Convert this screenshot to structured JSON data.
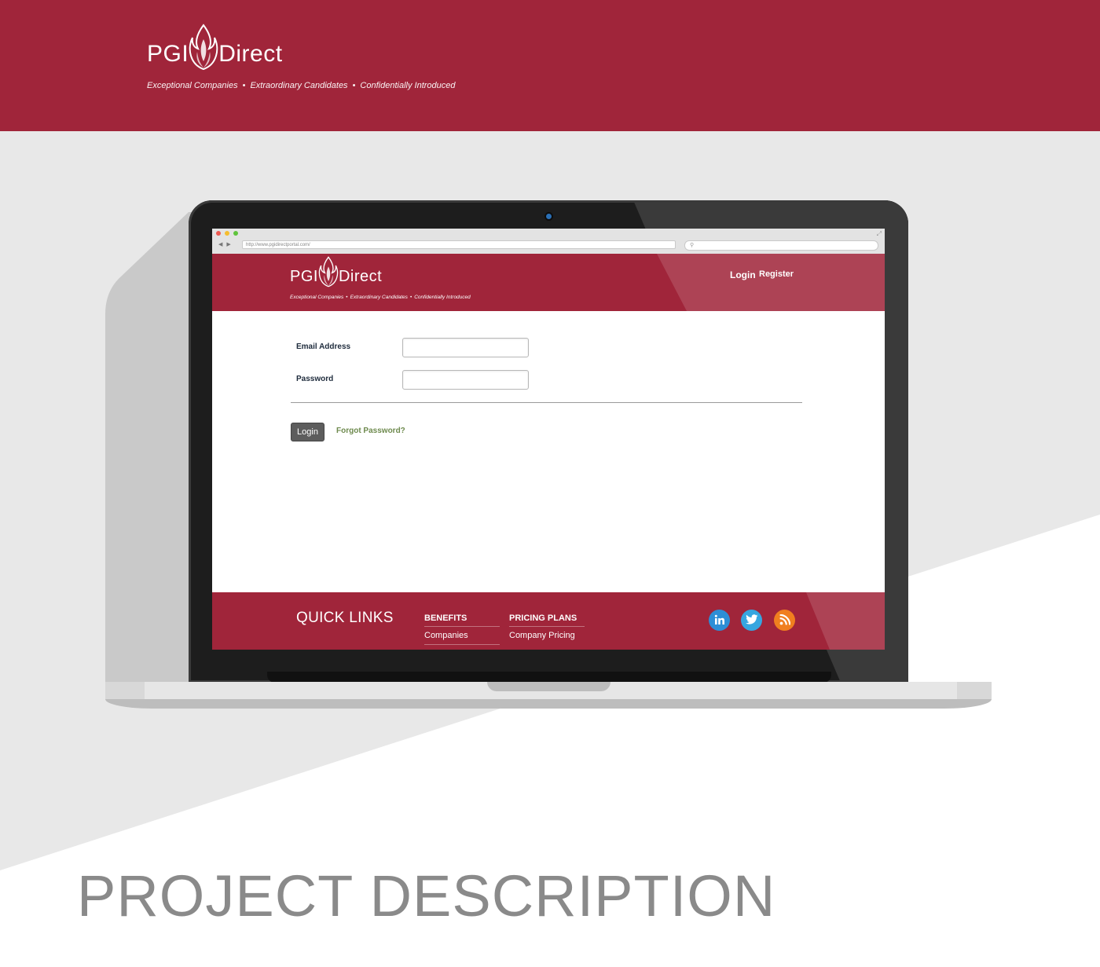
{
  "brand": {
    "name_left": "PGI",
    "name_right": "Direct",
    "tagline": [
      "Exceptional Companies",
      "Extraordinary Candidates",
      "Confidentially Introduced"
    ],
    "tagline_separator": "•",
    "color": "#a0253a"
  },
  "browser": {
    "url": "http://www.pgidirectportal.com/"
  },
  "site": {
    "nav": {
      "login": "Login",
      "register": "Register"
    },
    "form": {
      "email_label": "Email Address",
      "password_label": "Password",
      "login_button": "Login",
      "forgot_link": "Forgot Password?"
    },
    "footer": {
      "heading": "QUICK LINKS",
      "columns": [
        {
          "title": "BENEFITS",
          "link": "Companies"
        },
        {
          "title": "PRICING PLANS",
          "link": "Company Pricing"
        }
      ],
      "social": [
        "linkedin-icon",
        "twitter-icon",
        "rss-icon"
      ]
    }
  },
  "page": {
    "heading": "PROJECT DESCRIPTION"
  }
}
